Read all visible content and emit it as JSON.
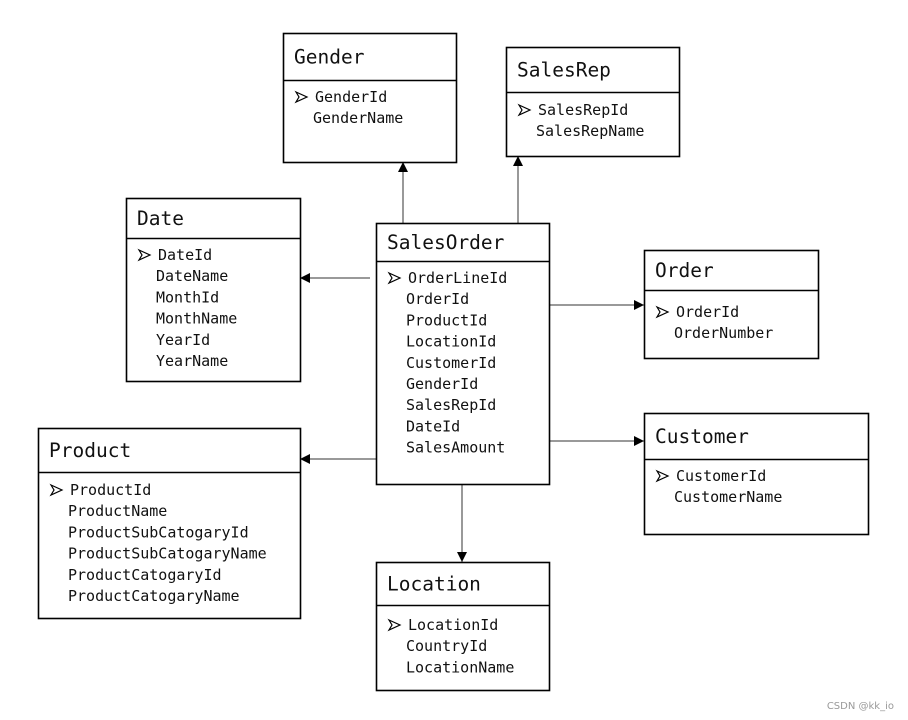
{
  "entities": [
    {
      "id": "gender",
      "title": "Gender",
      "primary_key": "GenderId",
      "fields": [
        "GenderName"
      ]
    },
    {
      "id": "salesrep",
      "title": "SalesRep",
      "primary_key": "SalesRepId",
      "fields": [
        "SalesRepName"
      ]
    },
    {
      "id": "date",
      "title": "Date",
      "primary_key": "DateId",
      "fields": [
        "DateName",
        "MonthId",
        "MonthName",
        "YearId",
        "YearName"
      ]
    },
    {
      "id": "salesorder",
      "title": "SalesOrder",
      "primary_key": "OrderLineId",
      "fields": [
        "OrderId",
        "ProductId",
        "LocationId",
        "CustomerId",
        "GenderId",
        "SalesRepId",
        "DateId",
        "SalesAmount"
      ]
    },
    {
      "id": "order",
      "title": "Order",
      "primary_key": "OrderId",
      "fields": [
        "OrderNumber"
      ]
    },
    {
      "id": "product",
      "title": "Product",
      "primary_key": "ProductId",
      "fields": [
        "ProductName",
        "ProductSubCatogaryId",
        "ProductSubCatogaryName",
        "ProductCatogaryId",
        "ProductCatogaryName"
      ]
    },
    {
      "id": "customer",
      "title": "Customer",
      "primary_key": "CustomerId",
      "fields": [
        "CustomerName"
      ]
    },
    {
      "id": "location",
      "title": "Location",
      "primary_key": "LocationId",
      "fields": [
        "CountryId",
        "LocationName"
      ]
    }
  ],
  "relationships": [
    {
      "from": "SalesOrder",
      "to": "Gender"
    },
    {
      "from": "SalesOrder",
      "to": "SalesRep"
    },
    {
      "from": "SalesOrder",
      "to": "Date"
    },
    {
      "from": "SalesOrder",
      "to": "Order"
    },
    {
      "from": "SalesOrder",
      "to": "Product"
    },
    {
      "from": "SalesOrder",
      "to": "Customer"
    },
    {
      "from": "SalesOrder",
      "to": "Location"
    }
  ],
  "primary_key_marker_icon": "arrowhead-bullet",
  "watermark": "CSDN @kk_io"
}
